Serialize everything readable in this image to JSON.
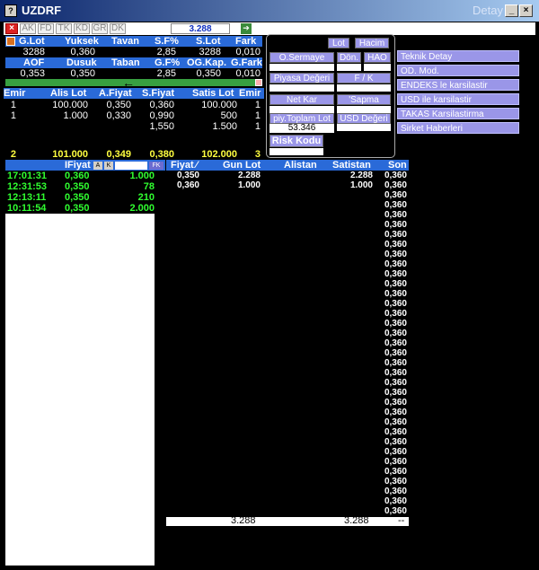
{
  "window": {
    "title": "UZDRF",
    "detay": "Detay"
  },
  "toolbar": {
    "buttons": [
      "AK",
      "FD",
      "TK",
      "KD",
      "GR",
      "DK"
    ],
    "price": "3.288"
  },
  "summary": {
    "headers1": [
      "G.Lot",
      "Yuksek",
      "Tavan",
      "S.F%",
      "S.Lot",
      "Fark"
    ],
    "values1": [
      "3288",
      "0,360",
      "",
      "2,85",
      "3288",
      "0,010"
    ],
    "headers2": [
      "AOF",
      "Dusuk",
      "Taban",
      "G.F%",
      "OG.Kap.",
      "G.Fark"
    ],
    "values2": [
      "0,353",
      "0,350",
      "",
      "2,85",
      "0,350",
      "0,010"
    ]
  },
  "depth": {
    "headers": [
      "Emir",
      "Alis Lot",
      "A.Fiyat",
      "S.Fiyat",
      "Satis Lot",
      "Emir"
    ],
    "rows": [
      [
        "1",
        "100.000",
        "0,350",
        "0,360",
        "100.000",
        "1"
      ],
      [
        "1",
        "1.000",
        "0,330",
        "0,990",
        "500",
        "1"
      ],
      [
        "",
        "",
        "",
        "1,550",
        "1.500",
        "1"
      ]
    ],
    "total": [
      "2",
      "101.000",
      "0,349",
      "0,380",
      "102.000",
      "3"
    ]
  },
  "popup": {
    "lot": "Lot",
    "hacim": "Hacim",
    "osermaye": "O.Sermaye",
    "don": "Dön.",
    "hao": "HAO",
    "piyasa_degeri": "Piyasa Değeri",
    "fk": "F / K",
    "net_kar": "Net Kar",
    "sapma": "'Sapma",
    "piy_toplam_lot": "piy.Toplam Lot",
    "usd_degeri": "USD Değeri",
    "toplam_val": "53.346",
    "risk_kodu": "Risk Kodu"
  },
  "sidemenu": [
    "Teknik Detay",
    "OD. Mod.",
    "ENDEKS le karsilastir",
    "USD ile karsilastir",
    "TAKAS Karsilastirma",
    "Sirket Haberleri"
  ],
  "trades": {
    "header": "IFiyat",
    "btn_a": "A",
    "btn_k": "K",
    "btn_fk": "FK",
    "rows": [
      [
        "17:01:31",
        "0,360",
        "1.000"
      ],
      [
        "12:31:53",
        "0,350",
        "78"
      ],
      [
        "12:13:11",
        "0,350",
        "210"
      ],
      [
        "10:11:54",
        "0,350",
        "2.000"
      ]
    ]
  },
  "price_table": {
    "headers": [
      "Fiyat",
      "Gun Lot",
      "Alistan",
      "Satistan",
      "Son"
    ],
    "rows": [
      [
        "0,350",
        "2.288",
        "",
        "2.288"
      ],
      [
        "0,360",
        "1.000",
        "",
        "1.000"
      ]
    ],
    "son_value": "0,360",
    "footer_lot": "3.288",
    "footer_satistan": "3.288",
    "footer_dash": "--"
  }
}
